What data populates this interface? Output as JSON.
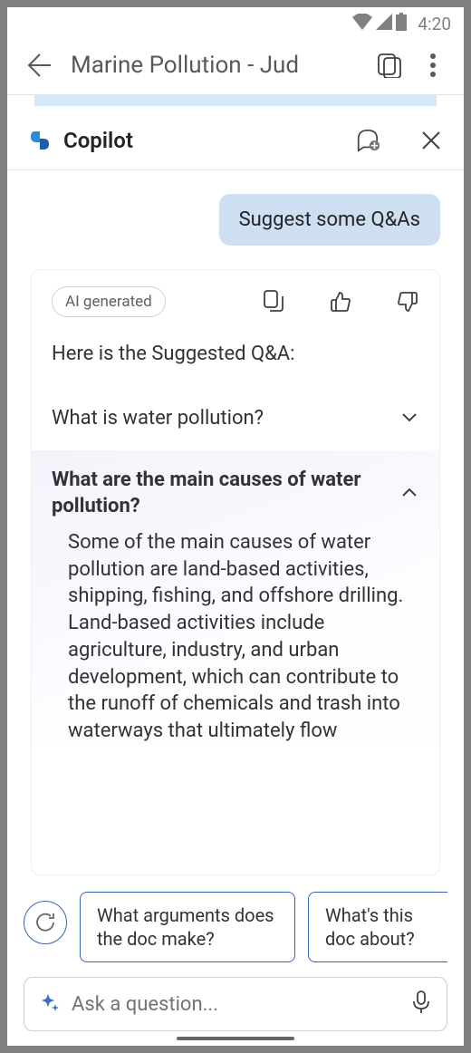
{
  "status": {
    "time": "4:20"
  },
  "doc_header": {
    "title": "Marine Pollution - Jud"
  },
  "copilot": {
    "title": "Copilot"
  },
  "chat": {
    "user_msg": "Suggest some Q&As",
    "ai_badge": "AI generated",
    "intro": "Here is the Suggested Q&A:",
    "qa": [
      {
        "question": "What is water pollution?",
        "answer": "",
        "expanded": false
      },
      {
        "question": "What are the main causes of water pollution?",
        "answer": "Some of the main causes of water pollution are land-based activities, shipping, fishing, and offshore drilling. Land-based activities include agriculture, industry, and urban development, which can contribute to the runoff of chemicals and trash into waterways that ultimately flow",
        "expanded": true
      }
    ]
  },
  "suggestions": [
    "What arguments does the doc make?",
    "What's this doc about?"
  ],
  "input": {
    "placeholder": "Ask a question..."
  }
}
